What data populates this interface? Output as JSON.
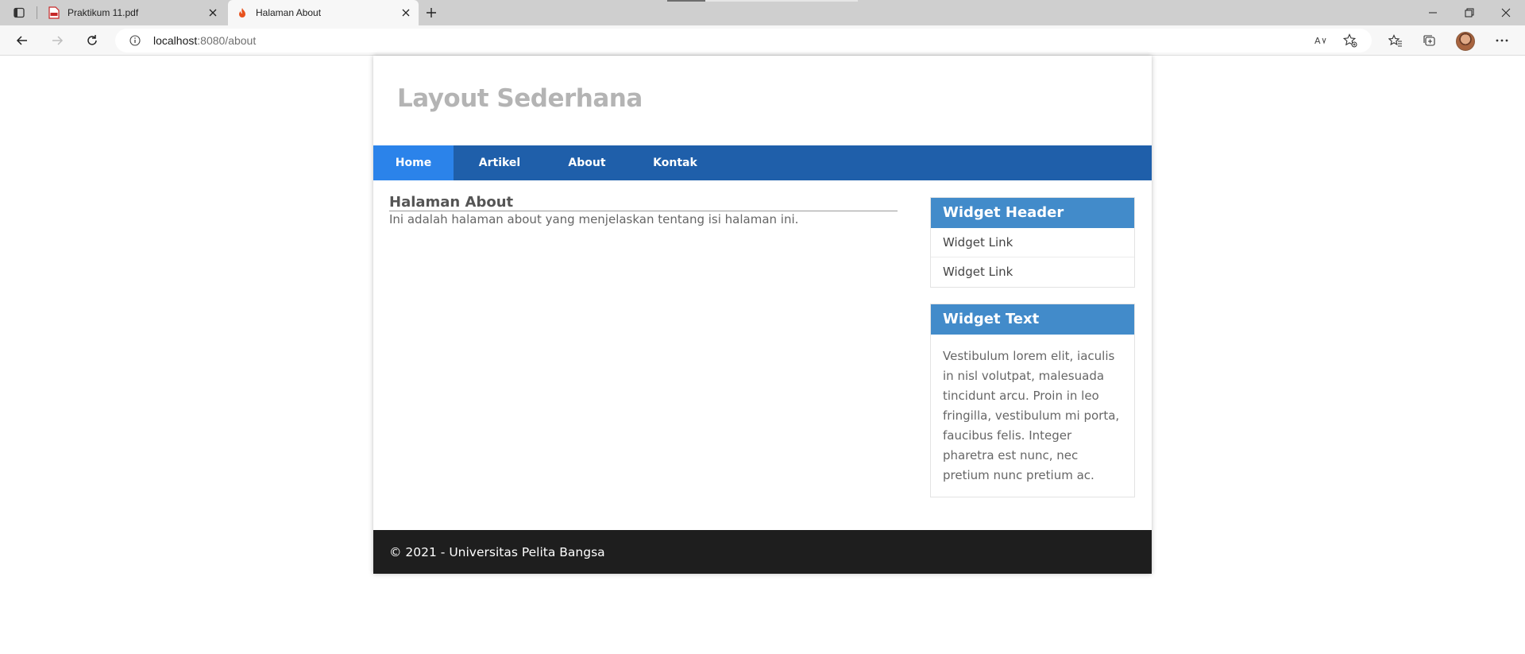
{
  "browser": {
    "tabs": [
      {
        "title": "Praktikum 11.pdf",
        "icon": "pdf-icon"
      },
      {
        "title": "Halaman About",
        "icon": "flame-icon"
      }
    ],
    "url_host": "localhost",
    "url_path": ":8080/about",
    "icons": [
      "workspaces-icon",
      "new-tab-icon",
      "minimize-icon",
      "restore-icon",
      "close-icon",
      "back-icon",
      "forward-icon",
      "refresh-icon",
      "info-icon",
      "read-aloud-icon",
      "add-favorite-icon",
      "favorites-icon",
      "collections-icon",
      "profile-avatar",
      "more-icon"
    ]
  },
  "site": {
    "title": "Layout Sederhana",
    "nav": [
      "Home",
      "Artikel",
      "About",
      "Kontak"
    ],
    "nav_active": "Home",
    "colors": {
      "nav": "#1f5faa",
      "nav_active": "#2b83ea",
      "widget_header": "#428bca",
      "footer": "#1e1e1e"
    }
  },
  "main": {
    "heading": "Halaman About",
    "body": "Ini adalah halaman about yang menjelaskan tentang isi halaman ini."
  },
  "sidebar": {
    "widget1": {
      "header": "Widget Header",
      "links": [
        "Widget Link",
        "Widget Link"
      ]
    },
    "widget2": {
      "header": "Widget Text",
      "text": "Vestibulum lorem elit, iaculis in nisl volutpat, malesuada tincidunt arcu. Proin in leo fringilla, vestibulum mi porta, faucibus felis. Integer pharetra est nunc, nec pretium nunc pretium ac."
    }
  },
  "footer": {
    "text": "© 2021 - Universitas Pelita Bangsa"
  }
}
